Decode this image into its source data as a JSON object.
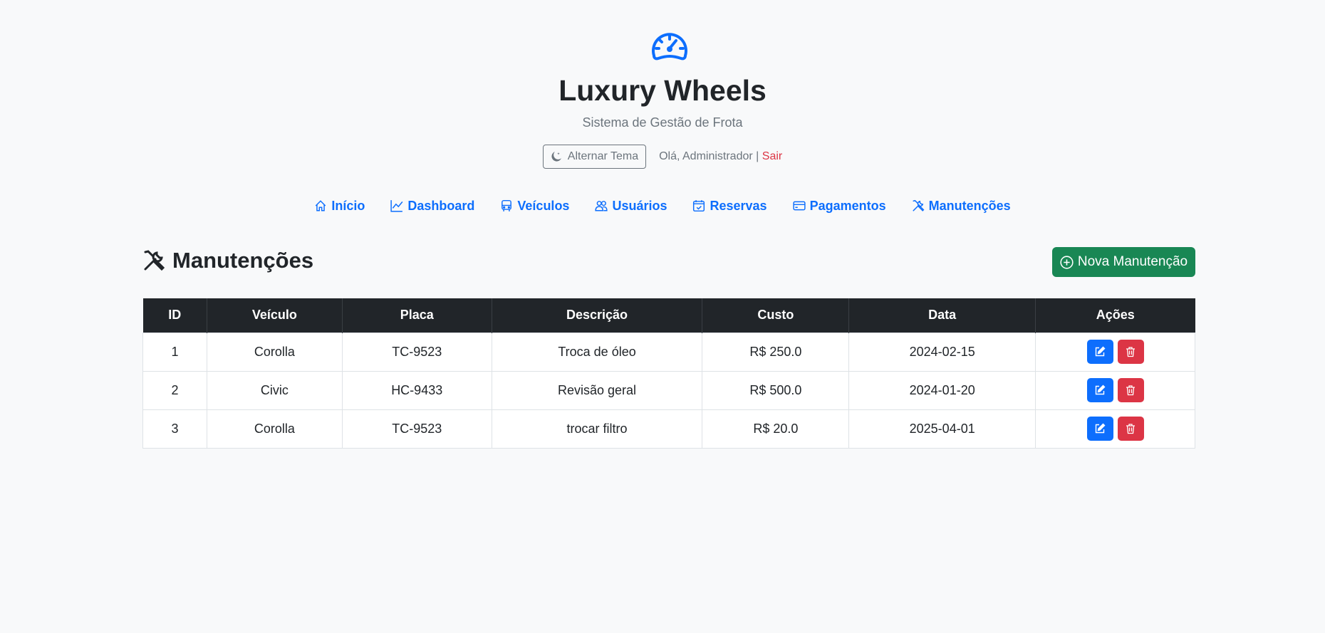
{
  "brand": {
    "logo_icon": "speedometer-icon",
    "title": "Luxury Wheels",
    "subtitle": "Sistema de Gestão de Frota"
  },
  "user_bar": {
    "theme_toggle_label": "Alternar Tema",
    "theme_icon": "moon-icon",
    "greeting": "Olá, Administrador |",
    "logout_label": "Sair"
  },
  "nav": {
    "items": [
      {
        "label": "Início",
        "icon": "house-icon"
      },
      {
        "label": "Dashboard",
        "icon": "graph-up-icon"
      },
      {
        "label": "Veículos",
        "icon": "bus-icon"
      },
      {
        "label": "Usuários",
        "icon": "people-icon"
      },
      {
        "label": "Reservas",
        "icon": "calendar-check-icon"
      },
      {
        "label": "Pagamentos",
        "icon": "credit-card-icon"
      },
      {
        "label": "Manutenções",
        "icon": "tools-icon"
      }
    ]
  },
  "page": {
    "title": "Manutenções",
    "title_icon": "tools-icon",
    "new_button_label": "Nova Manutenção"
  },
  "table": {
    "headers": [
      "ID",
      "Veículo",
      "Placa",
      "Descrição",
      "Custo",
      "Data",
      "Ações"
    ],
    "rows": [
      [
        "1",
        "Corolla",
        "TC-9523",
        "Troca de óleo",
        "R$ 250.0",
        "2024-02-15"
      ],
      [
        "2",
        "Civic",
        "HC-9433",
        "Revisão geral",
        "R$ 500.0",
        "2024-01-20"
      ],
      [
        "3",
        "Corolla",
        "TC-9523",
        "trocar filtro",
        "R$ 20.0",
        "2025-04-01"
      ]
    ]
  },
  "colors": {
    "primary": "#0d6efd",
    "success": "#198754",
    "danger": "#dc3545",
    "dark": "#212529",
    "muted": "#6c757d",
    "background": "#f8f9fa"
  }
}
